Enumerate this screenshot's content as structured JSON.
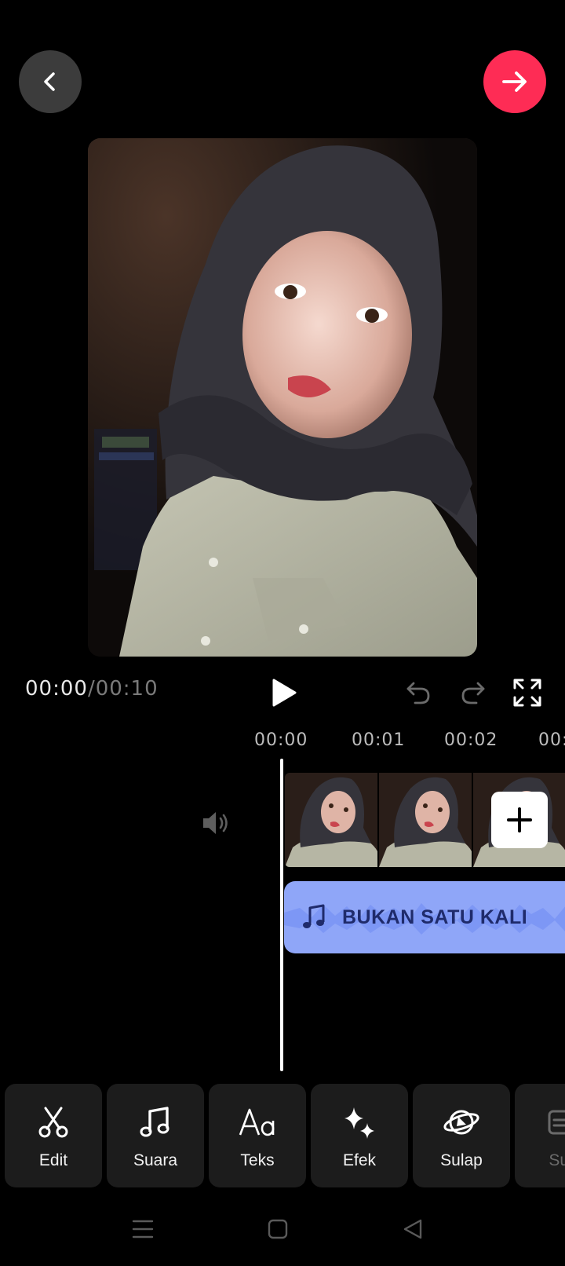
{
  "playback": {
    "current_time": "00:00",
    "separator": "/",
    "total_time": "00:10"
  },
  "timeline": {
    "ruler": [
      "00:00",
      "00:01",
      "00:02",
      "00:"
    ],
    "music_track_title": "BUKAN SATU KALI"
  },
  "tools": [
    {
      "label": "Edit",
      "icon": "scissors-icon"
    },
    {
      "label": "Suara",
      "icon": "music-note-icon"
    },
    {
      "label": "Teks",
      "icon": "text-aa-icon"
    },
    {
      "label": "Efek",
      "icon": "sparkle-icon"
    },
    {
      "label": "Sulap",
      "icon": "magic-planet-icon"
    },
    {
      "label": "Sub",
      "icon": "subtitle-icon"
    }
  ],
  "colors": {
    "accent": "#fe2c55",
    "music_track": "#8fa6f8",
    "music_text": "#1f2b6b",
    "tool_bg": "#1c1c1c"
  }
}
